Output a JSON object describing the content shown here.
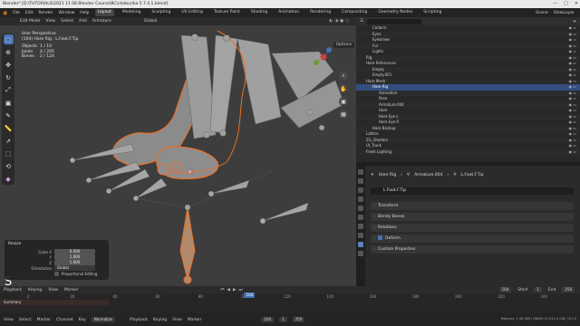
{
  "window": {
    "title": "Blender* [D:\\TUTORIALS\\2021 11 08 Blender Course\\BC\\cheburika 5.7.4.1.blend]",
    "controls": [
      "—",
      "□",
      "✕"
    ]
  },
  "menubar": {
    "menus": [
      "File",
      "Edit",
      "Render",
      "Window",
      "Help"
    ],
    "workspaces": [
      "Layout",
      "Modeling",
      "Sculpting",
      "UV Editing",
      "Texture Paint",
      "Shading",
      "Animation",
      "Rendering",
      "Compositing",
      "Geometry Nodes",
      "Scripting"
    ],
    "active_workspace": "Layout",
    "scene": "Scene",
    "view_layer": "ViewLayer"
  },
  "viewport_header": {
    "mode": "Edit Mode",
    "menus": [
      "View",
      "Select",
      "Add",
      "Armature"
    ],
    "orientation": "Global",
    "options": "Options"
  },
  "viewport": {
    "view_name": "User Perspective",
    "object_name": "(104) Hare Rig : L.Foot.F.Tip",
    "stats": [
      {
        "label": "Objects",
        "value": "1 / 10"
      },
      {
        "label": "Joints",
        "value": "4 / 205"
      },
      {
        "label": "Bones",
        "value": "2 / 124"
      }
    ],
    "toolbar_icons": [
      "select-box-icon",
      "cursor-icon",
      "move-icon",
      "rotate-icon",
      "scale-icon",
      "transform-icon",
      "annotate-icon",
      "measure-icon",
      "extrude-icon",
      "bone-size-icon",
      "roll-icon",
      "envelope-icon"
    ],
    "colors": {
      "background": "#3d3d3d",
      "bone": "#9a9a9a",
      "selection": "#e8702a"
    }
  },
  "operator_panel": {
    "title": "Resize",
    "key_hint": "S",
    "fields": [
      {
        "label": "Scale X",
        "value": "0.000"
      },
      {
        "label": "Y",
        "value": "1.000"
      },
      {
        "label": "Z",
        "value": "1.000"
      }
    ],
    "orientation_label": "Orientation",
    "orientation_value": "Global",
    "proportional": "Proportional Editing"
  },
  "outliner": {
    "search_placeholder": "",
    "items": [
      {
        "label": "Cedarin",
        "indent": 2,
        "selected": false
      },
      {
        "label": "Eyes",
        "indent": 2,
        "selected": false
      },
      {
        "label": "Eyebrows",
        "indent": 2,
        "selected": false
      },
      {
        "label": "Fur",
        "indent": 2,
        "selected": false
      },
      {
        "label": "Lights",
        "indent": 2,
        "selected": false
      },
      {
        "label": "Rig",
        "indent": 1,
        "selected": false
      },
      {
        "label": "Hare References",
        "indent": 1,
        "selected": false
      },
      {
        "label": "Empty",
        "indent": 2,
        "selected": false
      },
      {
        "label": "Empty.001",
        "indent": 2,
        "selected": false
      },
      {
        "label": "Hare Mesh",
        "indent": 1,
        "selected": false
      },
      {
        "label": "Hare Rig",
        "indent": 2,
        "selected": true
      },
      {
        "label": "Animation",
        "indent": 3,
        "selected": false
      },
      {
        "label": "Pose",
        "indent": 3,
        "selected": false
      },
      {
        "label": "Armature.004",
        "indent": 3,
        "selected": false
      },
      {
        "label": "Hare",
        "indent": 3,
        "selected": false
      },
      {
        "label": "Hare Eye L",
        "indent": 3,
        "selected": false
      },
      {
        "label": "Hare Eye R",
        "indent": 3,
        "selected": false
      },
      {
        "label": "Hare Backup",
        "indent": 2,
        "selected": false
      },
      {
        "label": "Lattice",
        "indent": 1,
        "selected": false
      },
      {
        "label": "ZG_Shaders",
        "indent": 1,
        "selected": false
      },
      {
        "label": "UI_Trunk",
        "indent": 1,
        "selected": false
      },
      {
        "label": "Fresh Lighting",
        "indent": 1,
        "selected": false
      }
    ]
  },
  "properties": {
    "breadcrumb": [
      "Hare Rig",
      "Armature.004",
      "L.Foot.F.Tip"
    ],
    "bone_name": "L.Foot.F.Tip",
    "panels": [
      {
        "label": "Transform",
        "checkbox": false
      },
      {
        "label": "Bendy Bones",
        "checkbox": false
      },
      {
        "label": "Relations",
        "checkbox": false
      },
      {
        "label": "Deform",
        "checkbox": true
      },
      {
        "label": "Custom Properties",
        "checkbox": false
      }
    ]
  },
  "timeline": {
    "menus": [
      "Playback",
      "Keying",
      "View",
      "Marker"
    ],
    "current_frame": "104",
    "start_label": "Start",
    "start": "1",
    "end_label": "End",
    "end": "250",
    "ticks": [
      "0",
      "20",
      "40",
      "60",
      "80",
      "100",
      "120",
      "140",
      "160",
      "180",
      "200",
      "220",
      "240"
    ],
    "summary": "Summary"
  },
  "bottom": {
    "menus": [
      "View",
      "Select",
      "Marker",
      "Channel",
      "Key"
    ],
    "mode": "Normalize",
    "playback": [
      "Playback",
      "Keying",
      "View",
      "Marker"
    ],
    "frame": "104",
    "start": "1",
    "end": "250",
    "status": "Memory: 1.56 GiB | VRAM: 0.0/11.0 GiB | 3.0.0"
  }
}
